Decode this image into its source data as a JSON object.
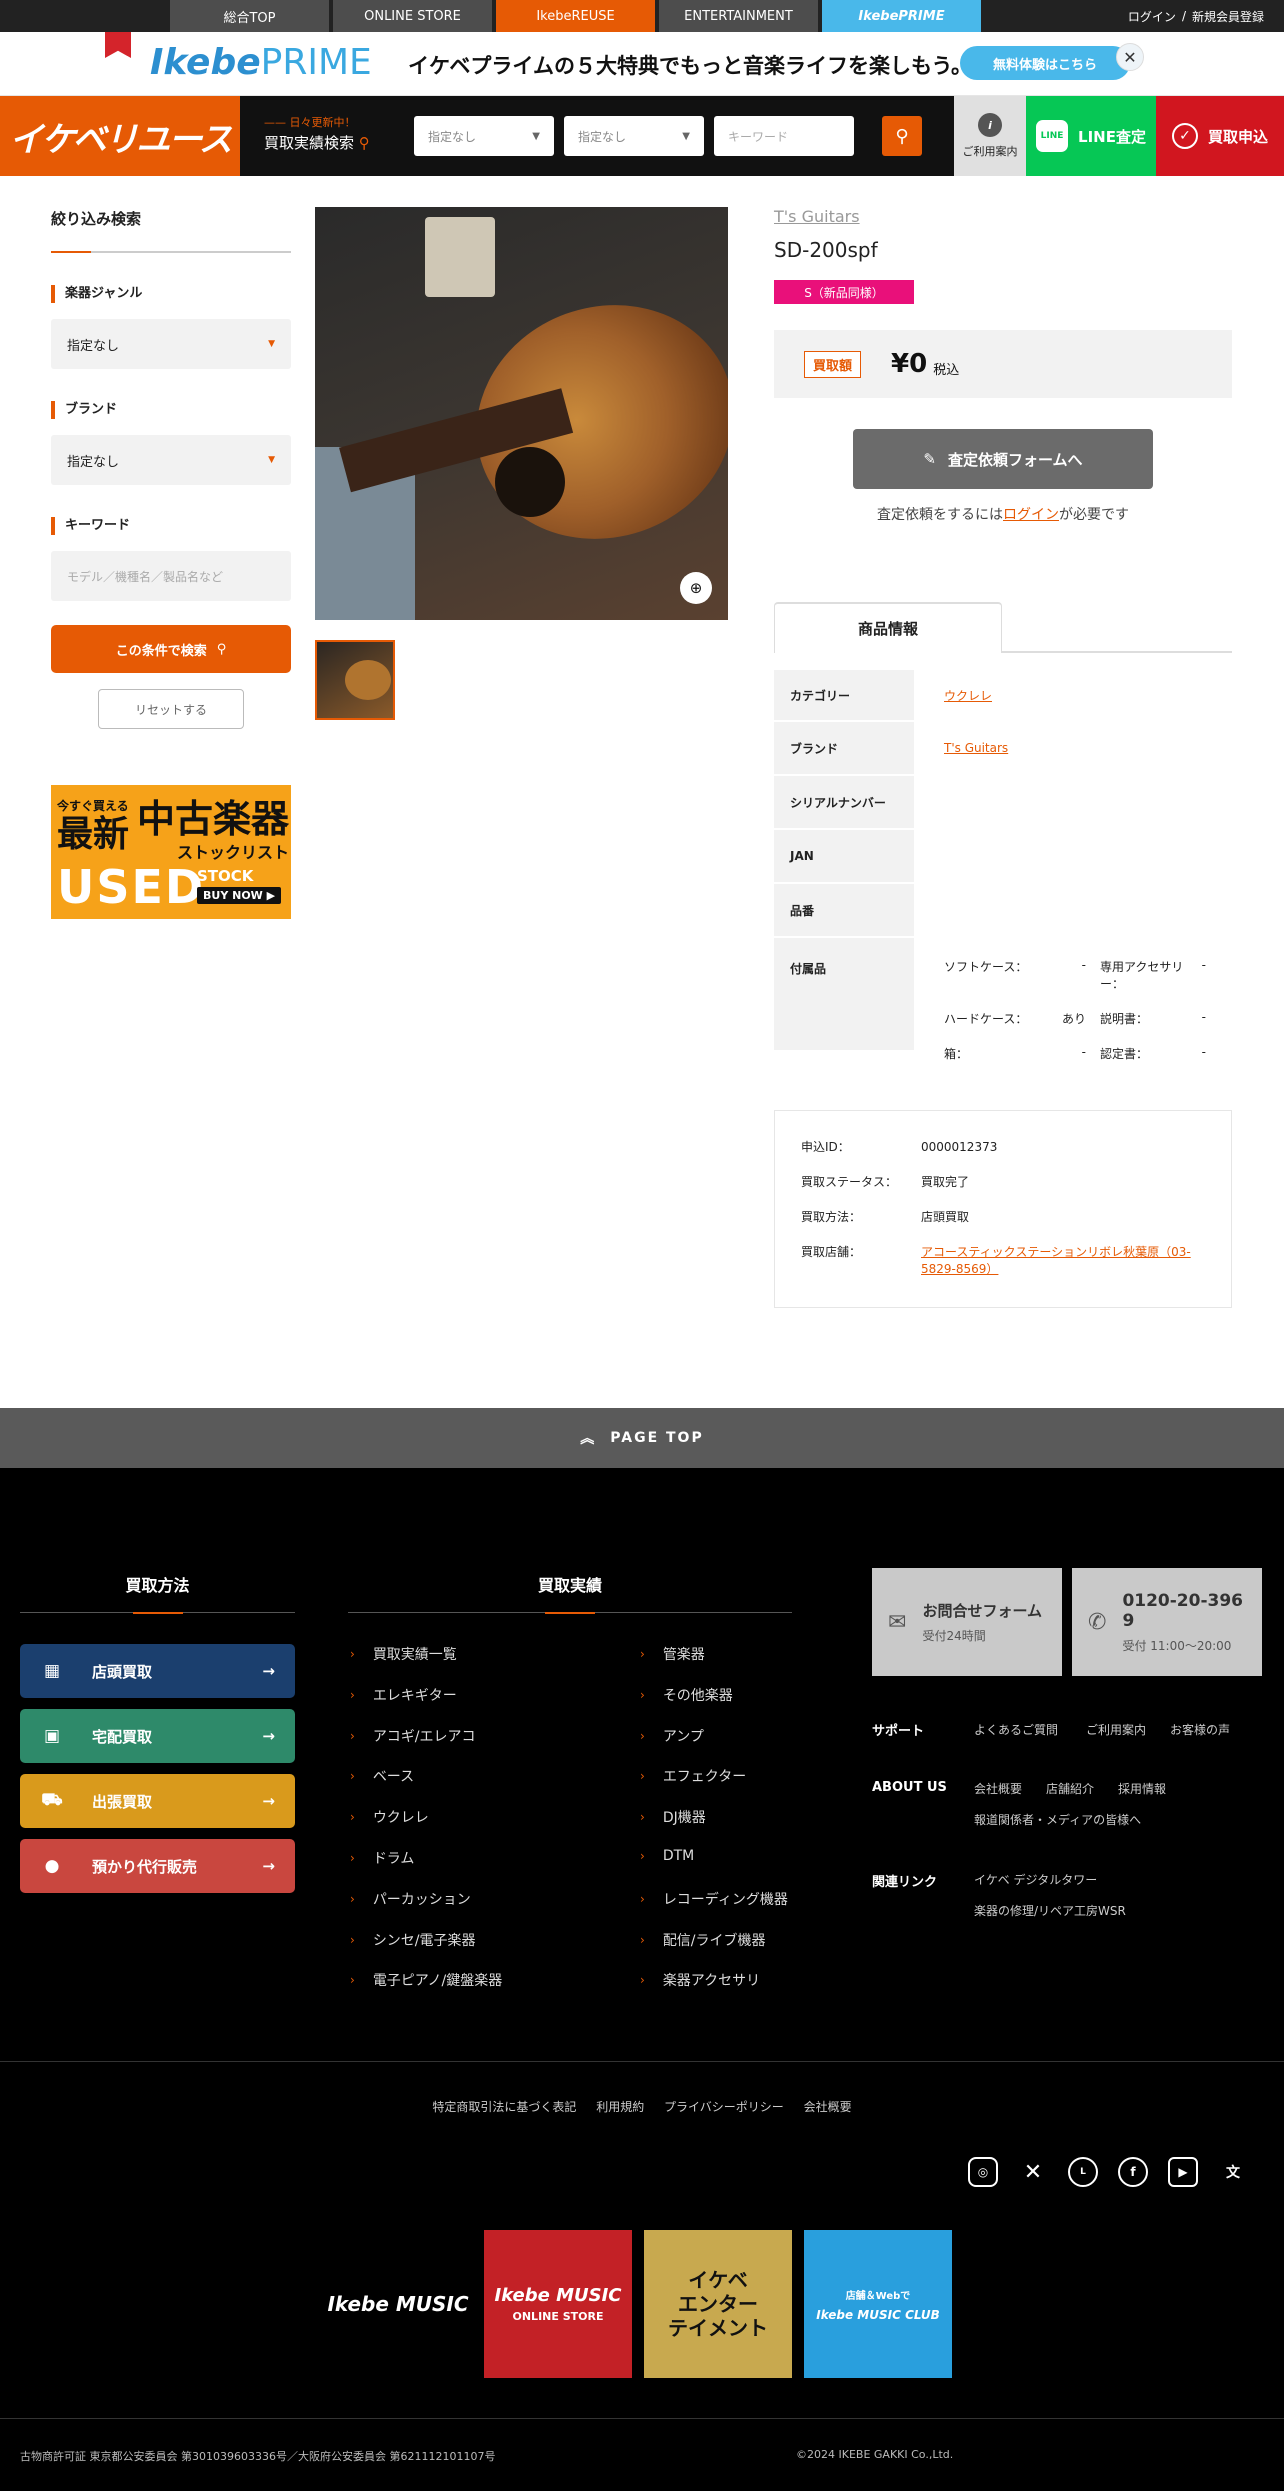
{
  "topnav": {
    "tabs": [
      "総合TOP",
      "ONLINE STORE",
      "IkebeREUSE",
      "ENTERTAINMENT",
      "IkebePRIME"
    ],
    "login": "ログイン",
    "sep": "/",
    "register": "新規会員登録"
  },
  "banner": {
    "logo_a": "Ikebe",
    "logo_b": "PRIME",
    "text": "イケベプライムの５大特典でもっと音楽ライフを楽しもう。",
    "cta": "無料体験はこちら",
    "close": "✕"
  },
  "header": {
    "brand": "イケベリユース",
    "history_small": "日々更新中！",
    "history_main": "買取実績検索",
    "select1": "指定なし",
    "select2": "指定なし",
    "keyword_placeholder": "キーワード",
    "guide": "ご利用案内",
    "line_badge": "LINE",
    "line_label": "LINE査定",
    "apply_label": "買取申込"
  },
  "sidebar": {
    "title": "絞り込み検索",
    "genre_label": "楽器ジャンル",
    "genre_value": "指定なし",
    "brand_label": "ブランド",
    "brand_value": "指定なし",
    "keyword_label": "キーワード",
    "keyword_placeholder": "モデル／機種名／製品名など",
    "search_button": "この条件で検索",
    "reset_button": "リセットする",
    "ad": {
      "line1": "今すぐ買える",
      "line2": "最新",
      "line3": "中古楽器",
      "line4": "ストックリスト",
      "line5": "USED",
      "line6": "STOCK LIST",
      "line7": "BUY NOW ▶"
    }
  },
  "product": {
    "brand": "T's Guitars",
    "model": "SD-200spf",
    "condition": "S（新品同様）",
    "price_label": "買取額",
    "price": "¥0",
    "tax": "税込",
    "assess_button": "査定依頼フォームへ",
    "note_pre": "査定依頼をするには",
    "note_link": "ログイン",
    "note_post": "が必要です",
    "tab": "商品情報"
  },
  "spec": {
    "category_k": "カテゴリー",
    "category_v": "ウクレレ",
    "brand_k": "ブランド",
    "brand_v": "T's Guitars",
    "serial_k": "シリアルナンバー",
    "jan_k": "JAN",
    "part_k": "品番",
    "acc_k": "付属品",
    "accessories": [
      {
        "k": "ソフトケース：",
        "v": "-"
      },
      {
        "k": "専用アクセサリー：",
        "v": "-"
      },
      {
        "k": "ハードケース：",
        "v": "あり"
      },
      {
        "k": "説明書：",
        "v": "-"
      },
      {
        "k": "箱：",
        "v": "-"
      },
      {
        "k": "認定書：",
        "v": "-"
      }
    ]
  },
  "order": {
    "id_k": "申込ID：",
    "id_v": "0000012373",
    "status_k": "買取ステータス：",
    "status_v": "買取完了",
    "method_k": "買取方法：",
    "method_v": "店頭買取",
    "store_k": "買取店舗：",
    "store_v": "アコースティックステーションリボレ秋葉原（03-5829-8569）"
  },
  "pagetop": "PAGE TOP",
  "footer": {
    "method_title": "買取方法",
    "methods": [
      {
        "label": "店頭買取",
        "color": "#1b3f6e"
      },
      {
        "label": "宅配買取",
        "color": "#2e8a6a"
      },
      {
        "label": "出張買取",
        "color": "#d99a1c"
      },
      {
        "label": "預かり代行販売",
        "color": "#c9473f"
      }
    ],
    "results_title": "買取実績",
    "results_left": [
      "買取実績一覧",
      "エレキギター",
      "アコギ/エレアコ",
      "ベース",
      "ウクレレ",
      "ドラム",
      "パーカッション",
      "シンセ/電子楽器",
      "電子ピアノ/鍵盤楽器"
    ],
    "results_right": [
      "管楽器",
      "その他楽器",
      "アンプ",
      "エフェクター",
      "DJ機器",
      "DTM",
      "レコーディング機器",
      "配信/ライブ機器",
      "楽器アクセサリ"
    ],
    "contact_form": "お問合せフォーム",
    "contact_form_sub": "受付24時間",
    "phone": "0120-20-3969",
    "phone_sub": "受付 11:00〜20:00",
    "support": "サポート",
    "support_links": [
      "よくあるご質問",
      "ご利用案内",
      "お客様の声"
    ],
    "about": "ABOUT US",
    "about_links": [
      "会社概要",
      "店舗紹介",
      "採用情報",
      "報道関係者・メディアの皆様へ"
    ],
    "related": "関連リンク",
    "related_links": [
      "イケベ デジタルタワー",
      "楽器の修理/リペア工房WSR"
    ],
    "legal": [
      "特定商取引法に基づく表記",
      "利用規約",
      "プライバシーポリシー",
      "会社概要"
    ],
    "sns": [
      "instagram-icon",
      "x-icon",
      "line-icon",
      "facebook-icon",
      "youtube-icon",
      "language-icon"
    ],
    "banner1": "Ikebe MUSIC",
    "banner2a": "Ikebe MUSIC",
    "banner2b": "ONLINE STORE",
    "banner3a": "イケベ",
    "banner3b": "エンター",
    "banner3c": "テイメント",
    "banner4a": "店舗＆Webで",
    "banner4b": "Ikebe MUSIC CLUB",
    "license": "古物商許可証 東京都公安委員会 第301039603336号／大阪府公安委員会 第621112101107号",
    "copyright": "©2024 IKEBE GAKKI Co.,Ltd."
  }
}
